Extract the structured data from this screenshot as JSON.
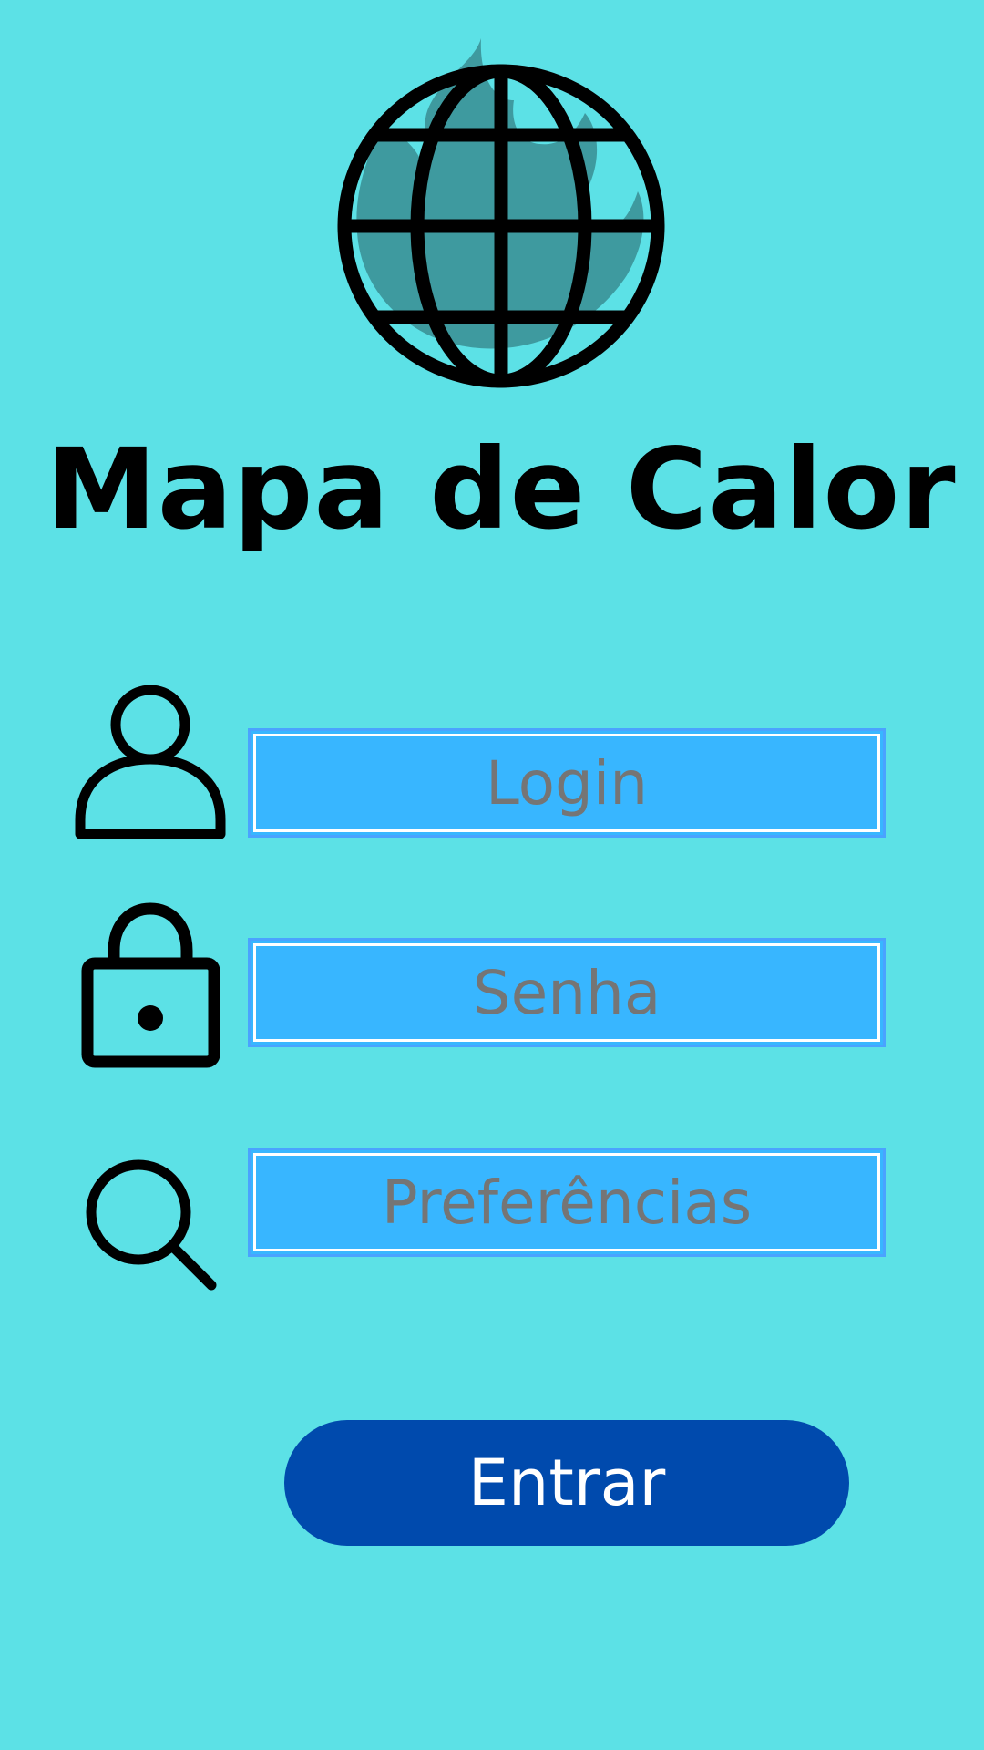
{
  "app": {
    "title": "Mapa de Calor",
    "logo_icon": "globe-icon",
    "logo_background_icon": "flame-icon"
  },
  "form": {
    "fields": [
      {
        "name": "login",
        "icon": "user-icon",
        "placeholder": "Login"
      },
      {
        "name": "senha",
        "icon": "lock-icon",
        "placeholder": "Senha"
      },
      {
        "name": "preferencias",
        "icon": "search-icon",
        "placeholder": "Preferências"
      }
    ],
    "submit_label": "Entrar"
  },
  "colors": {
    "background": "#5ce1e6",
    "field_fill": "#38b6ff",
    "field_border": "#4aa3ff",
    "placeholder_text": "#737373",
    "button": "#004aad",
    "flame": "#3e9a9f"
  }
}
